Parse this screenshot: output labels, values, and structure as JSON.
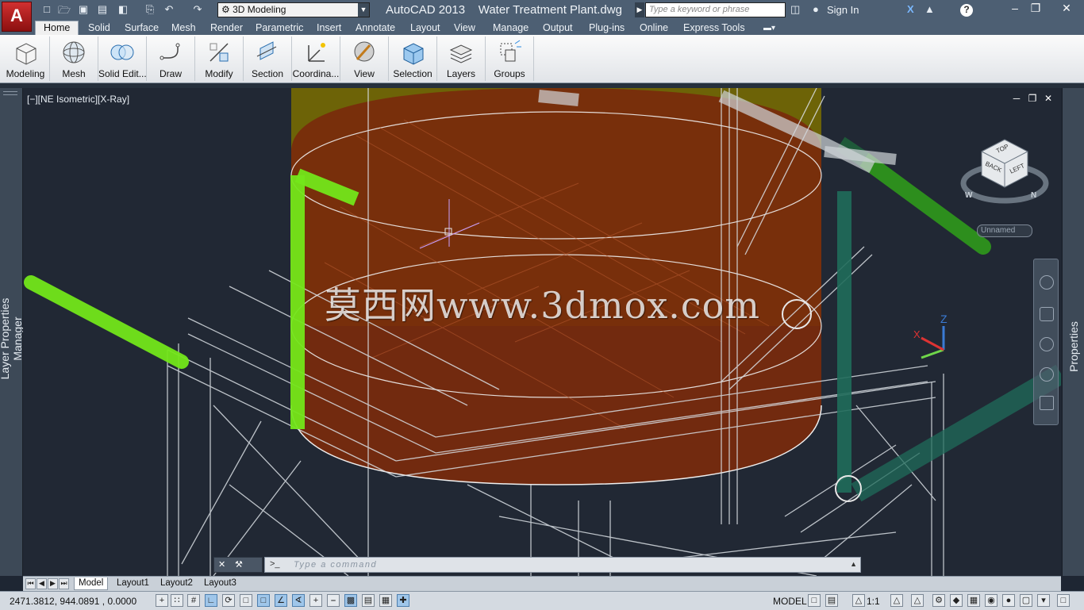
{
  "app": {
    "title": "AutoCAD 2013    Water Treatment Plant.dwg",
    "workspace": "3D Modeling",
    "search_placeholder": "Type a keyword or phrase",
    "sign_in": "Sign In",
    "app_button": "A"
  },
  "tabs": [
    "Home",
    "Solid",
    "Surface",
    "Mesh",
    "Render",
    "Parametric",
    "Insert",
    "Annotate",
    "Layout",
    "View",
    "Manage",
    "Output",
    "Plug-ins",
    "Online",
    "Express Tools"
  ],
  "ribbon": {
    "panels": [
      "Modeling",
      "Mesh",
      "Solid Edit...",
      "Draw",
      "Modify",
      "Section",
      "Coordina...",
      "View",
      "Selection",
      "Layers",
      "Groups"
    ]
  },
  "palettes": {
    "left": "Layer Properties Manager",
    "right": "Properties"
  },
  "viewport": {
    "label": "[−][NE Isometric][X-Ray]",
    "watermark": "莫西网www.3dmox.com",
    "ucs_label": "Unnamed",
    "viewcube": {
      "top": "TOP",
      "back": "BACK",
      "left": "LEFT",
      "w": "W",
      "n": "N"
    },
    "axis_x": "X",
    "axis_z": "Z"
  },
  "command_line": {
    "placeholder": "Type  a  command",
    "prompt_icon": ">_"
  },
  "layout_tabs": [
    "Model",
    "Layout1",
    "Layout2",
    "Layout3"
  ],
  "status": {
    "coordinates": "2471.3812, 944.0891 , 0.0000",
    "space": "MODEL",
    "scale": "1:1"
  },
  "colors": {
    "title_bar": "#4d5f73",
    "viewport_bg": "#212834",
    "tank": "#8a3010",
    "pipe_green": "#73e61a",
    "pipe_teal": "#1f6b5a"
  }
}
